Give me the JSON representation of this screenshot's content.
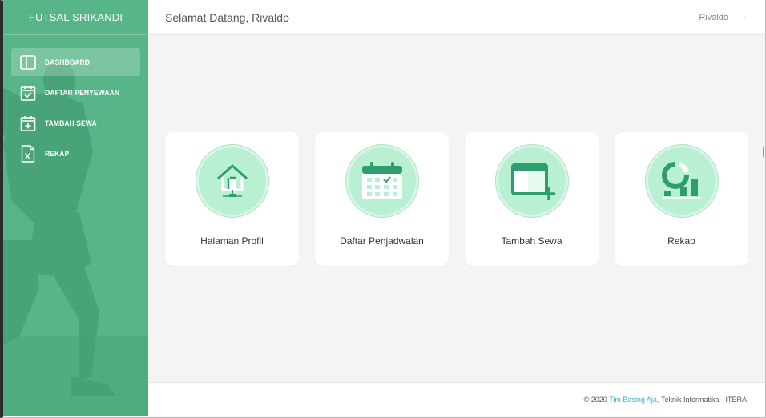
{
  "sidebar": {
    "brand": "FUTSAL SRIKANDI",
    "items": [
      {
        "label": "DASHBOARD",
        "icon": "layout-icon",
        "active": true
      },
      {
        "label": "DAFTAR PENYEWAAN",
        "icon": "calendar-check-icon",
        "active": false
      },
      {
        "label": "TAMBAH SEWA",
        "icon": "calendar-plus-icon",
        "active": false
      },
      {
        "label": "REKAP",
        "icon": "excel-file-icon",
        "active": false
      }
    ]
  },
  "header": {
    "title": "Selamat Datang, Rivaldo",
    "user": "Rivaldo",
    "caret": "-"
  },
  "cards": [
    {
      "label": "Halaman Profil",
      "icon": "home-icon"
    },
    {
      "label": "Daftar Penjadwalan",
      "icon": "calendar-icon"
    },
    {
      "label": "Tambah Sewa",
      "icon": "window-add-icon"
    },
    {
      "label": "Rekap",
      "icon": "chart-icon"
    }
  ],
  "footer": {
    "prefix": "© 2020",
    "link": "Tim Basing Aja,",
    "suffix": "Teknik Informatika - ITERA"
  },
  "colors": {
    "sidebar_green": "#4caf82",
    "icon_dark": "#2e9e6e",
    "icon_circle": "#b9efd3",
    "link": "#2fb3c8"
  }
}
